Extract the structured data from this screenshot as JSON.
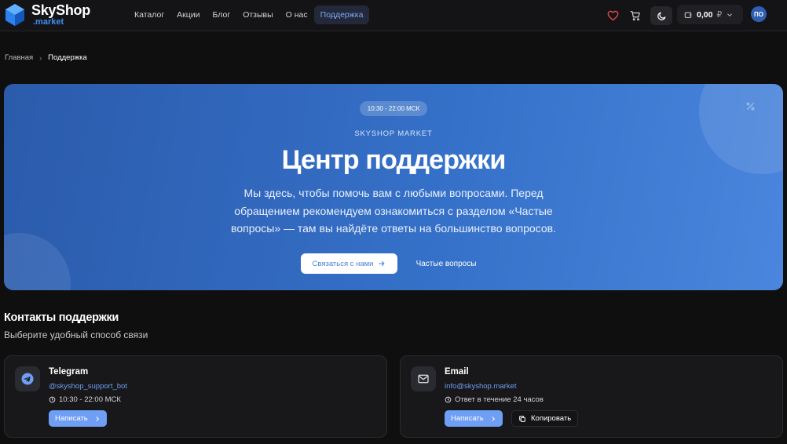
{
  "brand": {
    "name": "SkyShop",
    "sub": ".market"
  },
  "nav": [
    {
      "label": "Каталог"
    },
    {
      "label": "Акции"
    },
    {
      "label": "Блог"
    },
    {
      "label": "Отзывы"
    },
    {
      "label": "О нас"
    },
    {
      "label": "Поддержка",
      "active": true
    }
  ],
  "header": {
    "balance": "0,00",
    "currency": "₽",
    "avatar_initials": "ПО",
    "icons": [
      "heart-icon",
      "cart-icon",
      "moon-icon",
      "wallet-icon",
      "chevron-down-icon"
    ],
    "accent_heart": "#e5484d"
  },
  "breadcrumb": {
    "home": "Главная",
    "current": "Поддержка"
  },
  "hero": {
    "hours_badge": "10:30 - 22:00 МСК",
    "brand_label": "SKYSHOP MARKET",
    "title": "Центр поддержки",
    "text": "Мы здесь, чтобы помочь вам с любыми вопросами. Перед обращением рекомендуем ознакомиться с разделом «Частые вопросы» — там вы найдёте ответы на большинство вопросов.",
    "contact_button": "Связаться с нами",
    "faq_button": "Частые вопросы",
    "colors": {
      "start": "#2b5bab",
      "end": "#4a86dd"
    }
  },
  "contacts": {
    "title": "Контакты поддержки",
    "subtitle": "Выберите удобный способ связи",
    "cards": [
      {
        "title": "Telegram",
        "link": "@skyshop_support_bot",
        "meta": "10:30 - 22:00 МСК",
        "write_button": "Написать",
        "icon": "telegram-icon"
      },
      {
        "title": "Email",
        "link": "info@skyshop.market",
        "meta": "Ответ в течение 24 часов",
        "write_button": "Написать",
        "copy_button": "Копировать",
        "icon": "mail-icon"
      }
    ]
  }
}
